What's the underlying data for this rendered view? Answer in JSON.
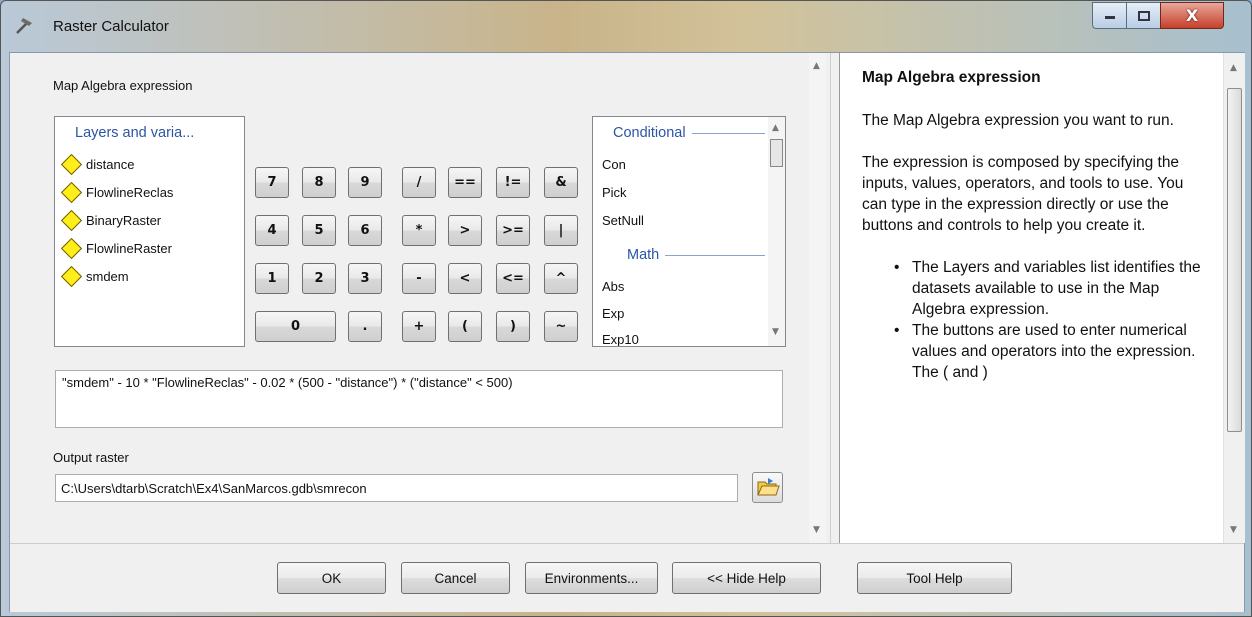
{
  "window": {
    "title": "Raster Calculator"
  },
  "expression_section": {
    "label": "Map Algebra expression"
  },
  "layers": {
    "header": "Layers and varia...",
    "items": [
      "distance",
      "FlowlineReclas",
      "BinaryRaster",
      "FlowlineRaster",
      "smdem"
    ]
  },
  "keypad": {
    "row1": [
      "7",
      "8",
      "9",
      "/",
      "==",
      "!=",
      "&"
    ],
    "row2": [
      "4",
      "5",
      "6",
      "*",
      ">",
      ">=",
      "|"
    ],
    "row3": [
      "1",
      "2",
      "3",
      "-",
      "<",
      "<=",
      "^"
    ],
    "row4": [
      "0",
      ".",
      "+",
      "(",
      ")",
      "~"
    ]
  },
  "functions": {
    "conditional_header": "Conditional",
    "conditional": [
      "Con",
      "Pick",
      "SetNull"
    ],
    "math_header": "Math",
    "math": [
      "Abs",
      "Exp",
      "Exp10"
    ]
  },
  "expression": {
    "value": "\"smdem\" - 10 * \"FlowlineReclas\" - 0.02 * (500 - \"distance\") * (\"distance\" < 500)"
  },
  "output": {
    "label": "Output raster",
    "value": "C:\\Users\\dtarb\\Scratch\\Ex4\\SanMarcos.gdb\\smrecon"
  },
  "help": {
    "title": "Map Algebra expression",
    "para1": "The Map Algebra expression you want to run.",
    "para2": "The expression is composed by specifying the inputs, values, operators, and tools to use. You can type in the expression directly or use the buttons and controls to help you create it.",
    "bullet1": "The Layers and variables list identifies the datasets available to use in the Map Algebra expression.",
    "bullet2": "The buttons are used to enter numerical values and operators into the expression. The ( and )"
  },
  "buttons": {
    "ok": "OK",
    "cancel": "Cancel",
    "environments": "Environments...",
    "hide_help": "<< Hide Help",
    "tool_help": "Tool Help"
  },
  "icons": [
    "calculator-icon",
    "minimize-icon",
    "maximize-icon",
    "close-icon",
    "layer-diamond-icon",
    "folder-browse-icon",
    "scroll-up-icon",
    "scroll-down-icon"
  ]
}
